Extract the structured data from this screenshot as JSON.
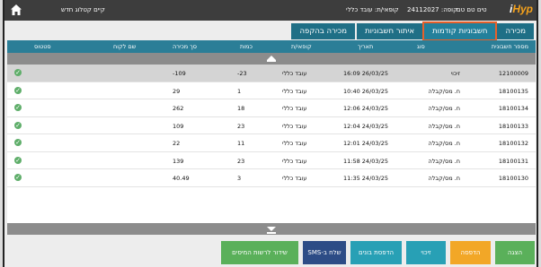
{
  "header": {
    "logo_prefix": "i",
    "logo_main": "Hyp",
    "store": "טים טם טם",
    "register_label": "קופה: 24112027",
    "agent": "קופאי/ת: עובד כללי",
    "new_customer": "קיים קטלוג חדש"
  },
  "tabs": [
    {
      "label": "מכירה"
    },
    {
      "label": "חשבוניות קודמות",
      "active": true
    },
    {
      "label": "איתור חשבוניות"
    },
    {
      "label": "מכירה בהקפה"
    }
  ],
  "table": {
    "columns": {
      "doc": "מספר חשבונית",
      "type": "סוג",
      "date": "תאריך",
      "cashier": "קופאי/ת",
      "qty": "כמות",
      "total": "סך מכירה",
      "customer": "שם לקוח",
      "status": "סטטוס"
    },
    "rows": [
      {
        "doc": "12100009",
        "type": "זיכוי",
        "date": "16:09 26/03/25",
        "cashier": "עובד כללי",
        "qty": "-23",
        "total": "-109",
        "customer": "",
        "status": "✓",
        "selected": true
      },
      {
        "doc": "18100135",
        "type": "ח. מס/קבלה",
        "date": "10:40 26/03/25",
        "cashier": "עובד כללי",
        "qty": "1",
        "total": "29",
        "customer": "",
        "status": "✓"
      },
      {
        "doc": "18100134",
        "type": "ח. מס/קבלה",
        "date": "12:06 24/03/25",
        "cashier": "עובד כללי",
        "qty": "18",
        "total": "262",
        "customer": "",
        "status": "✓"
      },
      {
        "doc": "18100133",
        "type": "ח. מס/קבלה",
        "date": "12:04 24/03/25",
        "cashier": "עובד כללי",
        "qty": "23",
        "total": "109",
        "customer": "",
        "status": "✓"
      },
      {
        "doc": "18100132",
        "type": "ח. מס/קבלה",
        "date": "12:01 24/03/25",
        "cashier": "עובד כללי",
        "qty": "11",
        "total": "22",
        "customer": "",
        "status": "✓"
      },
      {
        "doc": "18100131",
        "type": "ח. מס/קבלה",
        "date": "11:58 24/03/25",
        "cashier": "עובד כללי",
        "qty": "23",
        "total": "139",
        "customer": "",
        "status": "✓"
      },
      {
        "doc": "18100130",
        "type": "ח. מס/קבלה",
        "date": "11:35 24/03/25",
        "cashier": "עובד כללי",
        "qty": "3",
        "total": "40.49",
        "customer": "",
        "status": "✓"
      }
    ]
  },
  "buttons": {
    "show": "הצגה",
    "print": "הדפסה",
    "credit": "זיכוי",
    "print_vouchers": "הדפסת בונים",
    "send_sms": "שלח ב-SMS",
    "tax_broadcast": "שידור לרשות המיסים"
  },
  "colors": {
    "topbar": "#3d3d3d",
    "tab": "#1f6f86",
    "active_outline": "#e8602a",
    "header": "#2b7e97",
    "green": "#5ab05a",
    "orange": "#f2a727",
    "teal": "#28a0b5",
    "navy": "#2d4c86"
  }
}
